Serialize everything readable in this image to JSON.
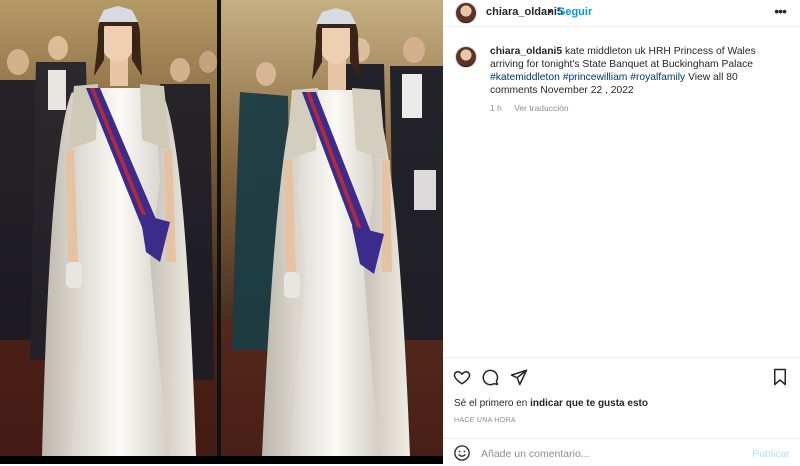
{
  "header": {
    "username": "chiara_oldani5",
    "separator": "•",
    "follow_label": "Seguir",
    "more_label": "•••"
  },
  "caption": {
    "username": "chiara_oldani5",
    "text": " kate middleton uk HRH Princess of Wales arriving for tonight's State Banquet at Buckingham Palace ",
    "hashtags": [
      "#katemiddleton",
      "#princewilliam",
      "#royalfamily"
    ],
    "tail": " View all 80 comments November 22 , 2022",
    "time": "1 h",
    "translate_label": "Ver traducción"
  },
  "actions": {
    "like_icon": "heart-icon",
    "comment_icon": "comment-icon",
    "share_icon": "paper-plane-icon",
    "save_icon": "bookmark-icon"
  },
  "likes": {
    "prefix": "Sé el primero en ",
    "bold": "indicar que te gusta esto"
  },
  "timestamp": "HACE UNA HORA",
  "comment_box": {
    "emoji_icon": "smiley-icon",
    "placeholder": "Añade un comentario...",
    "publish_label": "Publicar"
  },
  "colors": {
    "accent": "#0095f6",
    "publish_disabled": "#b2dffc",
    "hashtag": "#00376b",
    "secondary_text": "#8e8e8e",
    "sash": "#3b2c8c"
  }
}
